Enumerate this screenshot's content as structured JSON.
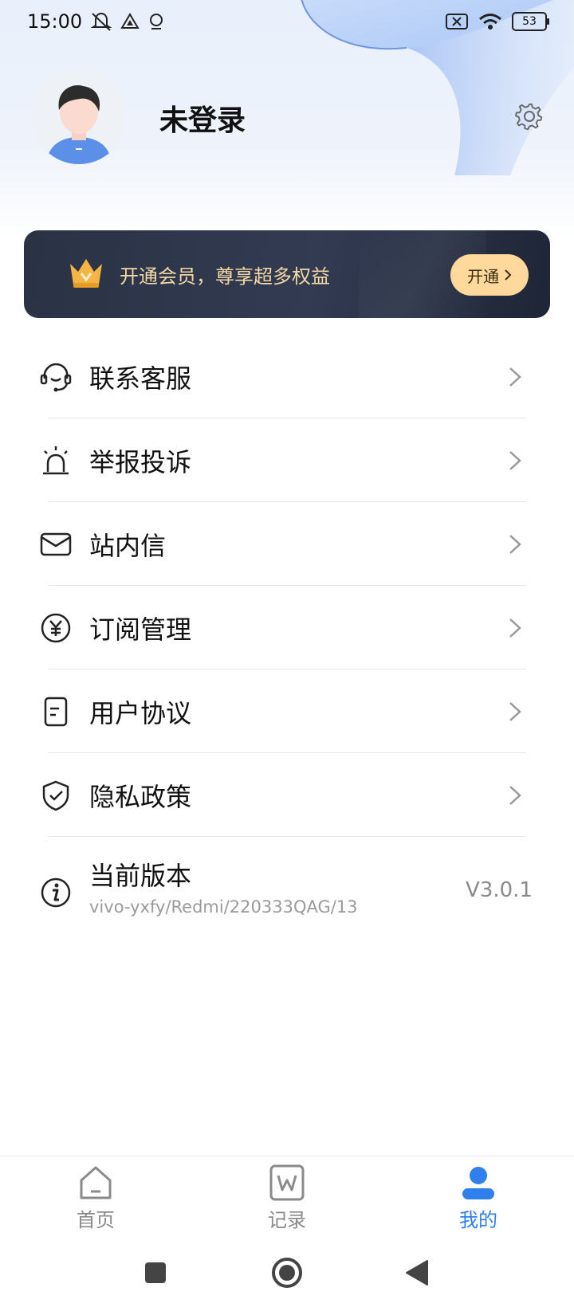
{
  "status_bar": {
    "time": "15:00",
    "battery": "53"
  },
  "profile": {
    "username": "未登录"
  },
  "vip_banner": {
    "text": "开通会员，尊享超多权益",
    "button_label": "开通"
  },
  "menu": [
    {
      "label": "联系客服",
      "icon": "headset-icon"
    },
    {
      "label": "举报投诉",
      "icon": "alarm-icon"
    },
    {
      "label": "站内信",
      "icon": "mail-icon"
    },
    {
      "label": "订阅管理",
      "icon": "yen-icon"
    },
    {
      "label": "用户协议",
      "icon": "document-icon"
    },
    {
      "label": "隐私政策",
      "icon": "shield-check-icon"
    }
  ],
  "version": {
    "title": "当前版本",
    "detail": "vivo-yxfy/Redmi/220333QAG/13",
    "value": "V3.0.1"
  },
  "tabbar": {
    "home": "首页",
    "record": "记录",
    "mine": "我的",
    "active_color": "#2f80ed"
  }
}
